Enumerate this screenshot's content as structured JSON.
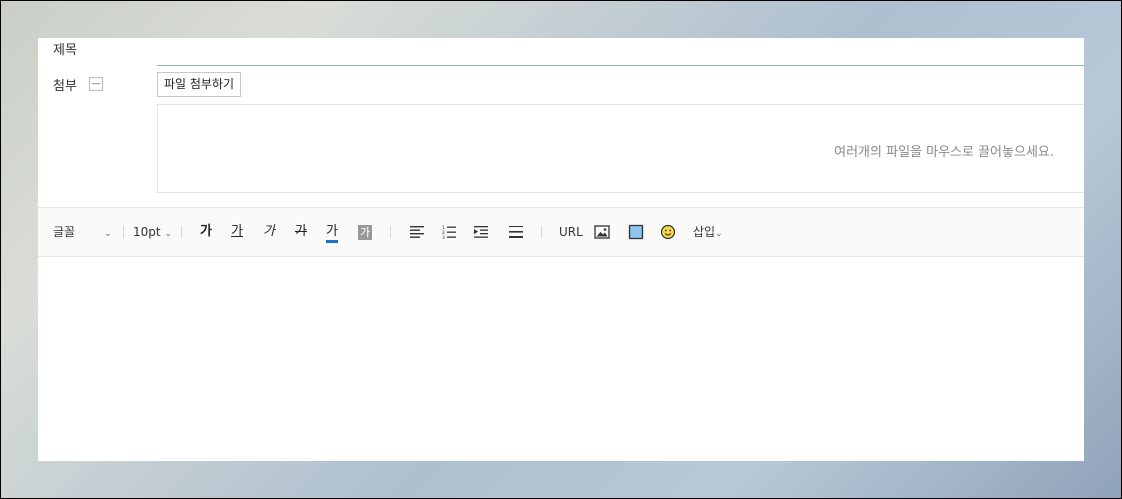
{
  "form": {
    "subject_label": "제목",
    "attach_label": "첨부",
    "collapse_symbol": "—",
    "attach_button_label": "파일 첨부하기",
    "drop_hint": "여러개의 파일을 마우스로 끌어놓으세요."
  },
  "toolbar": {
    "font_label": "글꼴",
    "font_size": "10pt",
    "bold_glyph": "가",
    "underline_glyph": "가",
    "italic_glyph": "가",
    "strike_glyph": "가",
    "font_color_glyph": "가",
    "bg_color_glyph": "가",
    "url_label": "URL",
    "insert_label": "삽입",
    "font_color_accent": "#1a73c8",
    "bg_color_fill": "#999999"
  }
}
